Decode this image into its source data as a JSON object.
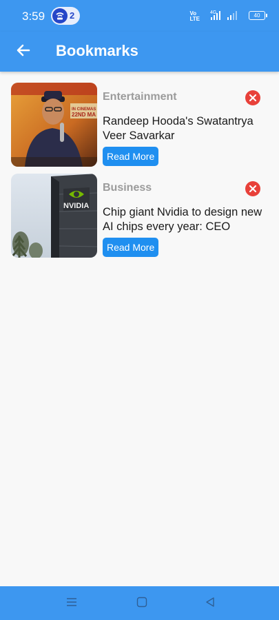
{
  "status": {
    "time": "3:59",
    "notification_count": "2",
    "network_label": "VoLTE",
    "signal_label": "4G",
    "battery": "40"
  },
  "appbar": {
    "title": "Bookmarks"
  },
  "bookmarks": [
    {
      "category": "Entertainment",
      "headline": "Randeep Hooda's Swatantrya Veer Savarkar",
      "button_label": "Read More",
      "poster_text": "IN CINEMAS 22ND MA"
    },
    {
      "category": "Business",
      "headline": "Chip giant Nvidia to design new AI chips every year: CEO",
      "button_label": "Read More",
      "sign_text": "NVIDIA"
    }
  ],
  "colors": {
    "primary": "#3d97f0",
    "button": "#1f8ff0",
    "remove": "#e8413a",
    "category_text": "#9b9b9b"
  }
}
